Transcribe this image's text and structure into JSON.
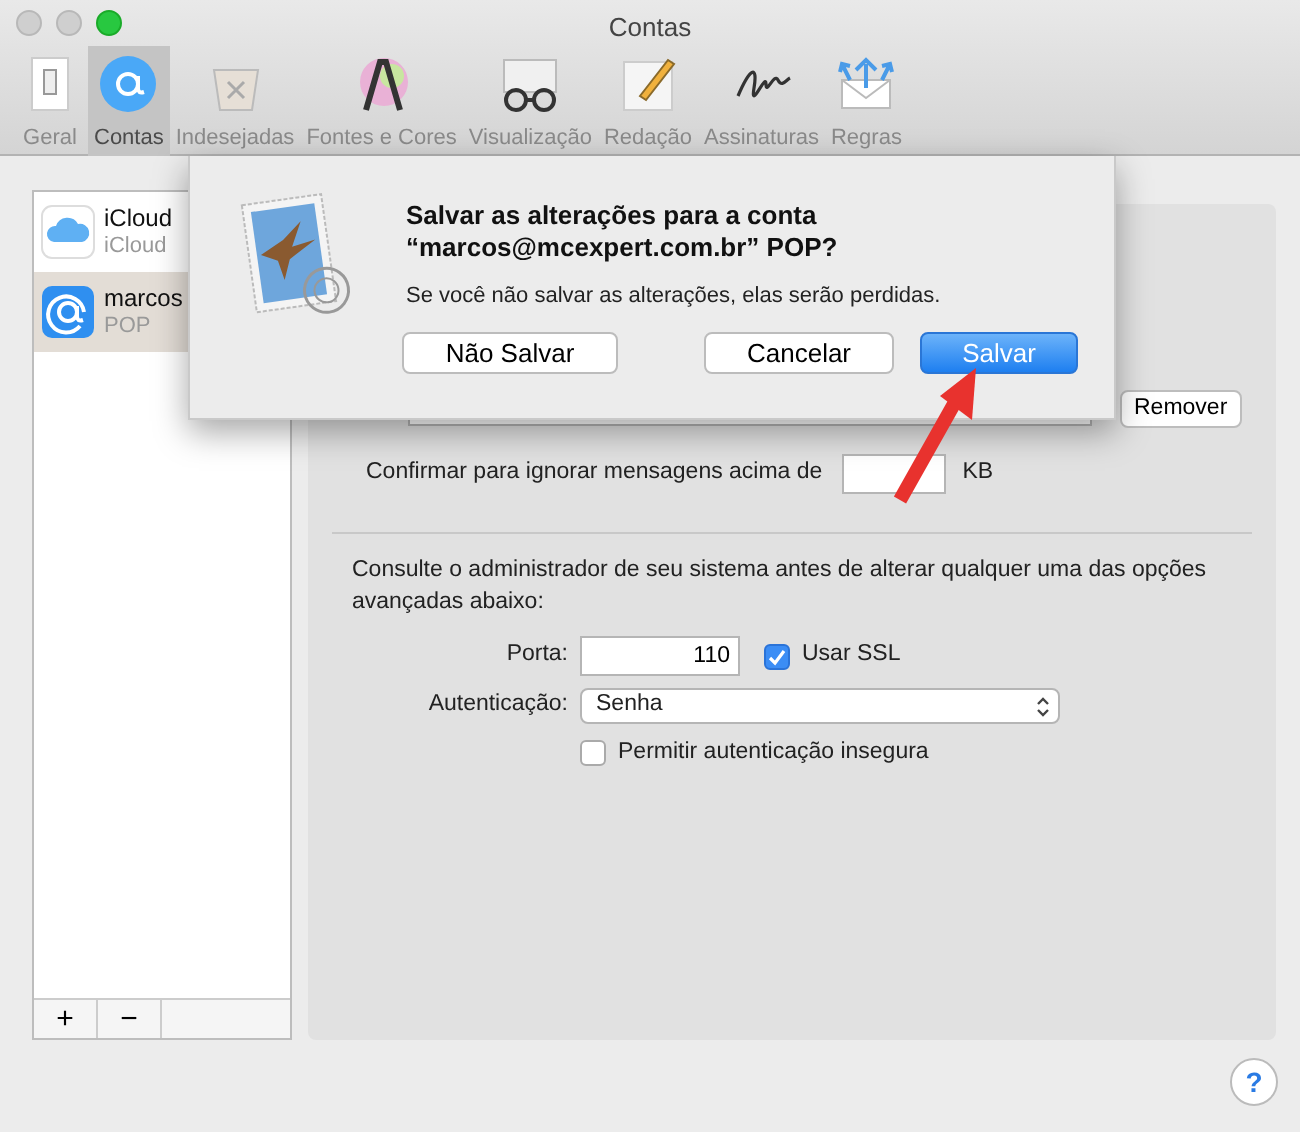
{
  "window": {
    "title": "Contas",
    "traffic_lights": [
      {
        "kind": "close",
        "active": false
      },
      {
        "kind": "minimize",
        "active": false
      },
      {
        "kind": "zoom",
        "active": true
      }
    ]
  },
  "toolbar": {
    "tabs": [
      {
        "label": "Geral",
        "selected": false
      },
      {
        "label": "Contas",
        "selected": true
      },
      {
        "label": "Indesejadas",
        "selected": false
      },
      {
        "label": "Fontes e Cores",
        "selected": false
      },
      {
        "label": "Visualização",
        "selected": false
      },
      {
        "label": "Redação",
        "selected": false
      },
      {
        "label": "Assinaturas",
        "selected": false
      },
      {
        "label": "Regras",
        "selected": false
      }
    ]
  },
  "accounts": [
    {
      "kind": "icloud",
      "name": "iCloud",
      "detail": "iCloud",
      "selected": false
    },
    {
      "kind": "at",
      "name": "marcos",
      "detail": "POP",
      "selected": true
    }
  ],
  "account_list_buttons": [
    "+",
    "−"
  ],
  "settings": {
    "remove_button": "Remover",
    "size_limit": {
      "label": "Confirmar para ignorar mensagens acima de",
      "unit": "KB"
    },
    "advanced_note": "Consulte o administrador de seu sistema antes de alterar qualquer uma das opções avançadas abaixo:",
    "port": {
      "label": "Porta:",
      "value": "110"
    },
    "use_ssl": {
      "label": "Usar SSL",
      "checked": true
    },
    "authentication": {
      "label": "Autenticação:",
      "value": "Senha"
    },
    "allow_insecure": {
      "label": "Permitir autenticação insegura",
      "checked": false
    }
  },
  "dialog": {
    "title_lines": [
      "Salvar as alterações para a conta",
      "“marcos@mcexpert.com.br” POP?"
    ],
    "message": "Se você não salvar as alterações, elas serão perdidas.",
    "buttons": [
      {
        "label": "Não Salvar",
        "default": false
      },
      {
        "label": "Cancelar",
        "default": false
      },
      {
        "label": "Salvar",
        "default": true
      }
    ]
  },
  "help_button": "?"
}
